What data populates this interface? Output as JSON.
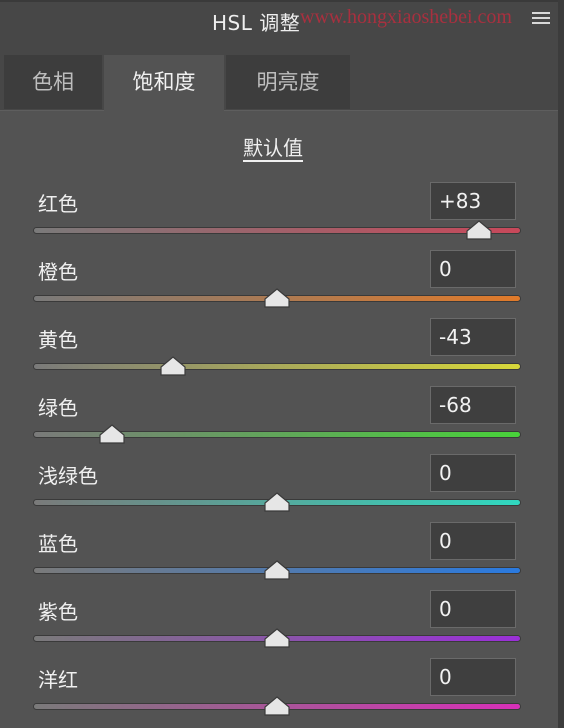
{
  "header": {
    "title": "HSL 调整",
    "watermark": "www.hongxiaoshebei.com"
  },
  "tabs": [
    {
      "label": "色相",
      "active": false
    },
    {
      "label": "饱和度",
      "active": true
    },
    {
      "label": "明亮度",
      "active": false
    }
  ],
  "defaults_label": "默认值",
  "sliders": [
    {
      "label": "红色",
      "value": "+83",
      "amount": 83,
      "colors": [
        "#7a7a7a",
        "#c8485a"
      ]
    },
    {
      "label": "橙色",
      "value": "0",
      "amount": 0,
      "colors": [
        "#7a7a7a",
        "#e07a2a"
      ]
    },
    {
      "label": "黄色",
      "value": "-43",
      "amount": -43,
      "colors": [
        "#7a7a7a",
        "#d8d83a"
      ]
    },
    {
      "label": "绿色",
      "value": "-68",
      "amount": -68,
      "colors": [
        "#7a7a7a",
        "#48d23a"
      ]
    },
    {
      "label": "浅绿色",
      "value": "0",
      "amount": 0,
      "colors": [
        "#7a7a7a",
        "#30d8c0"
      ]
    },
    {
      "label": "蓝色",
      "value": "0",
      "amount": 0,
      "colors": [
        "#7a7a7a",
        "#2a7ae0"
      ]
    },
    {
      "label": "紫色",
      "value": "0",
      "amount": 0,
      "colors": [
        "#7a7a7a",
        "#9a30d8"
      ]
    },
    {
      "label": "洋红",
      "value": "0",
      "amount": 0,
      "colors": [
        "#7a7a7a",
        "#d830b8"
      ]
    }
  ]
}
